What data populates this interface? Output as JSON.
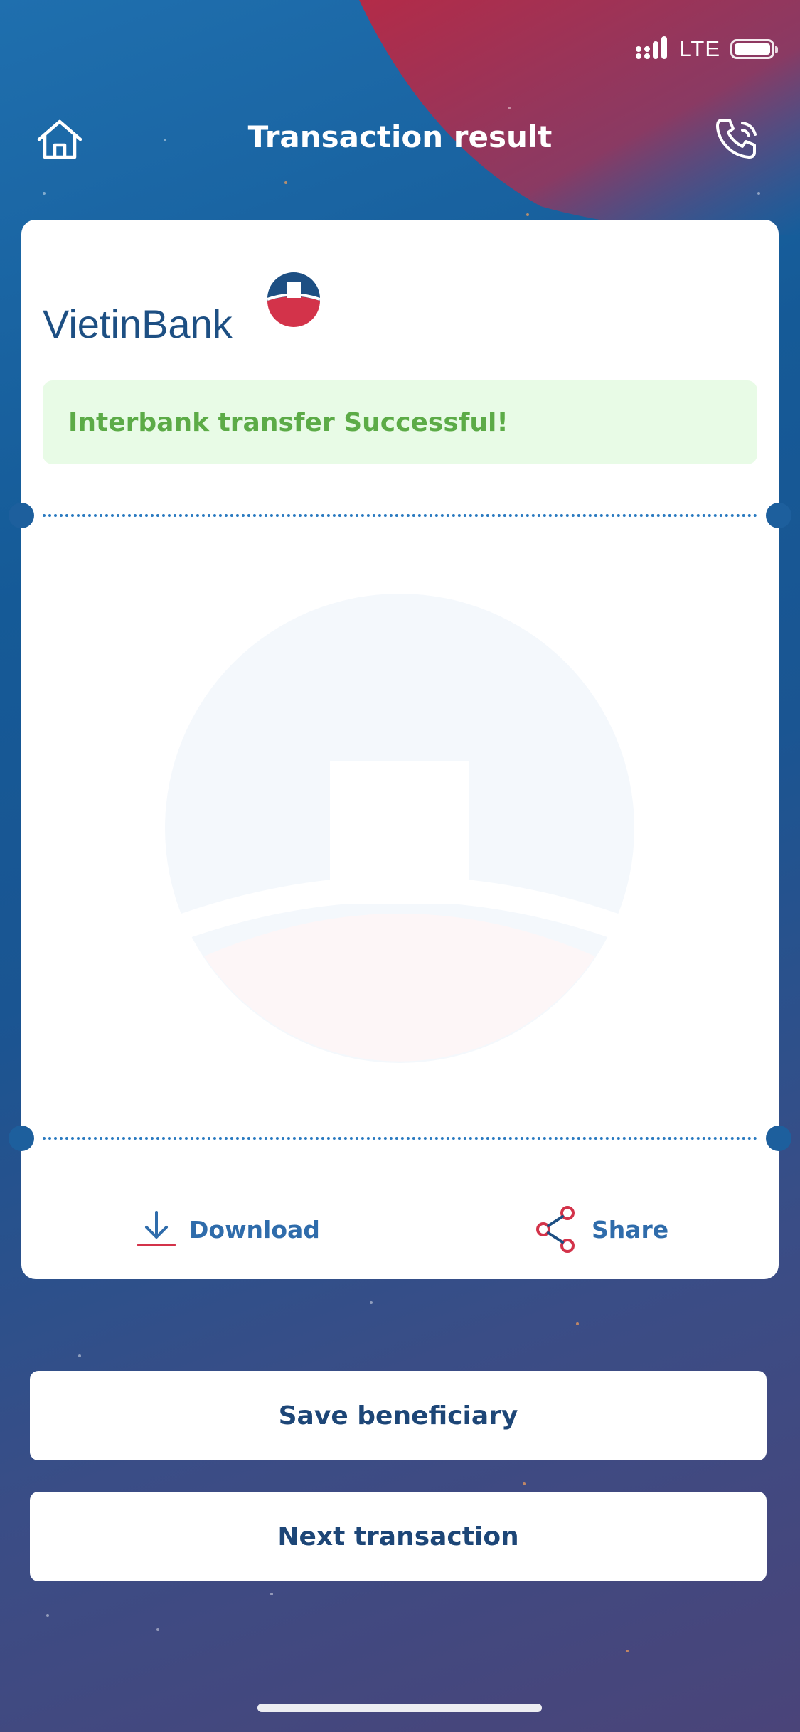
{
  "status_bar": {
    "network": "LTE"
  },
  "header": {
    "title": "Transaction result"
  },
  "logo": {
    "text": "VietinBank"
  },
  "result": {
    "message": "Interbank transfer Successful!"
  },
  "actions": {
    "download_label": "Download",
    "share_label": "Share"
  },
  "buttons": {
    "save_beneficiary": "Save beneficiary",
    "next_transaction": "Next transaction"
  },
  "colors": {
    "brand_blue": "#1d4f83",
    "brand_red": "#d3334a",
    "success_green": "#5cab47",
    "success_bg": "#e8fbe6",
    "accent_blue": "#2f6cab"
  },
  "icons": [
    "home-icon",
    "phone-call-icon",
    "download-icon",
    "share-icon",
    "signal-icon",
    "battery-icon"
  ]
}
